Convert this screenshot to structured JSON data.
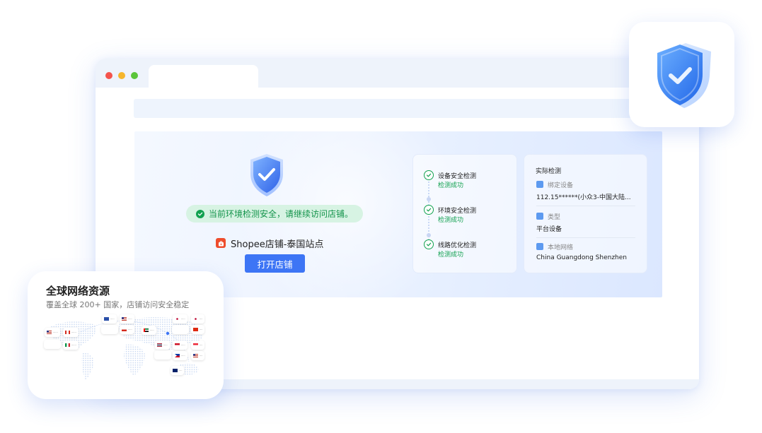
{
  "status": {
    "message": "当前环境检测安全，请继续访问店铺。"
  },
  "shop": {
    "name": "Shopee店铺-泰国站点",
    "open_button": "打开店铺"
  },
  "steps": [
    {
      "label": "设备安全检测",
      "result": "检测成功"
    },
    {
      "label": "环境安全检测",
      "result": "检测成功"
    },
    {
      "label": "线路优化检测",
      "result": "检测成功"
    }
  ],
  "info": {
    "title": "实际检测",
    "items": [
      {
        "label": "绑定设备",
        "value": "112.15******(小众3-中国大陆..."
      },
      {
        "label": "类型",
        "value": "平台设备"
      },
      {
        "label": "本地网络",
        "value": "China Guangdong Shenzhen"
      }
    ]
  },
  "network": {
    "title": "全球网络资源",
    "subtitle": "覆盖全球 200+ 国家，店铺访问安全稳定"
  },
  "colors": {
    "accent": "#3d75f5",
    "success": "#12a150",
    "success_bg": "#d7f3e3",
    "shopee": "#ee4d2d"
  },
  "icons": {
    "status": "check-circle-icon",
    "shop_logo": "shopee-bag-icon",
    "step": "check-circle-outline-icon",
    "info_item": "square-icon",
    "hero": "shield-check-icon"
  }
}
